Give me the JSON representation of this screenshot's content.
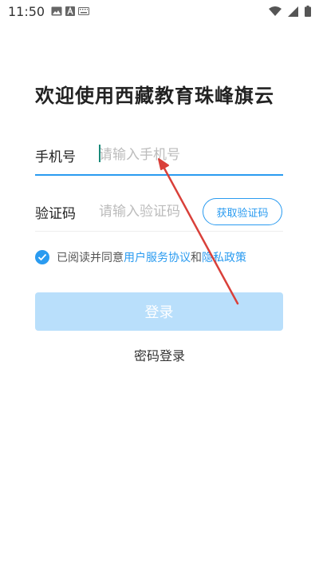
{
  "status_bar": {
    "time": "11:50",
    "left_icons": [
      "image-icon",
      "app-a-icon",
      "keyboard-icon"
    ],
    "right_icons": [
      "wifi-icon",
      "signal-icon",
      "battery-icon"
    ]
  },
  "page": {
    "title": "欢迎使用西藏教育珠峰旗云"
  },
  "phone": {
    "label": "手机号",
    "placeholder": "请输入手机号"
  },
  "code": {
    "label": "验证码",
    "placeholder": "请输入验证码",
    "button_label": "获取验证码"
  },
  "agreement": {
    "checked": true,
    "prefix": "已阅读并同意",
    "user_agreement": "用户服务协议",
    "and": "和",
    "privacy_policy": "隐私政策"
  },
  "actions": {
    "login_label": "登录",
    "password_login_label": "密码登录"
  },
  "colors": {
    "accent": "#2a9bf0",
    "login_button_disabled": "#b9dffb",
    "annotation_arrow": "#d9403a"
  }
}
